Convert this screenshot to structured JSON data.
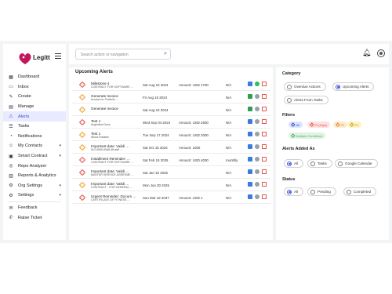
{
  "brand": {
    "name": "Legitt"
  },
  "sidebar": {
    "items": [
      {
        "label": "Dashboard",
        "icon": "grid-icon"
      },
      {
        "label": "Inbox",
        "icon": "inbox-icon"
      },
      {
        "label": "Create",
        "icon": "edit-icon"
      },
      {
        "label": "Manage",
        "icon": "folder-icon"
      },
      {
        "label": "Alerts",
        "icon": "alert-icon",
        "active": true
      },
      {
        "label": "Tasks",
        "icon": "tasks-icon"
      },
      {
        "label": "Notifications",
        "icon": "bell-icon"
      },
      {
        "label": "My Contacts",
        "icon": "contacts-icon",
        "caret": "▾"
      },
      {
        "label": "Smart Contract",
        "icon": "contract-icon",
        "caret": "▾"
      },
      {
        "label": "Repo Analyzer",
        "icon": "analyzer-icon"
      },
      {
        "label": "Reports & Analytics",
        "icon": "chart-icon"
      },
      {
        "label": "Org Settings",
        "icon": "org-icon",
        "caret": "▾"
      },
      {
        "label": "Settings",
        "icon": "gear-icon",
        "caret": "▾"
      },
      {
        "label": "Feedback",
        "icon": "feedback-icon"
      },
      {
        "label": "Raise Ticket",
        "icon": "ticket-icon"
      }
    ]
  },
  "search": {
    "placeholder": "Search action or navigation"
  },
  "alerts": {
    "title": "Upcoming Alerts",
    "rows": [
      {
        "title": "Milestone 4",
        "sub": "CONTRACT FOR SOFTWARE ...",
        "date": "Sat Aug 10 2024",
        "amount": "Amount: USD 1700",
        "freq": "N/A",
        "color": "#e5534b",
        "cal": "blue",
        "check": "green"
      },
      {
        "title": "Generate Invoice",
        "sub": "Invoice for Portfolio ...",
        "date": "Fri Aug 16 2024",
        "amount": "",
        "freq": "N/A",
        "color": "#f0a030",
        "cal": "green",
        "check": "grey"
      },
      {
        "title": "Generate Invoice",
        "sub": "",
        "date": "Sat Aug 10 2024",
        "amount": "",
        "freq": "N/A",
        "color": "#f0a030",
        "cal": "green",
        "check": "grey"
      },
      {
        "title": "Test 1",
        "sub": "Argentina Docs",
        "date": "Wed Sep 04 2024",
        "amount": "Amount: USD 2500",
        "freq": "N/A",
        "color": "#e5534b",
        "cal": "blue",
        "check": "grey"
      },
      {
        "title": "Test 1",
        "sub": "About Instates",
        "date": "Tue Sep 17 2024",
        "amount": "Amount: USD 2000",
        "freq": "N/A",
        "color": "#f0a030",
        "cal": "blue",
        "check": "grey"
      },
      {
        "title": "Important date: Validi ...",
        "sub": "5c718994-f5d8-4ff-ab8 ...",
        "date": "Sat Oct 15 2024",
        "amount": "Amount: 1000",
        "freq": "N/A",
        "color": "#f0a030",
        "cal": "blue",
        "check": "grey"
      },
      {
        "title": "Installment Reminder: ...",
        "sub": "CONTRACT FOR SOFTWARE ...",
        "date": "Sat Feb 15 2025",
        "amount": "Amount: USD 4000",
        "freq": "monthly",
        "color": "#e5534b",
        "cal": "blue",
        "check": "grey"
      },
      {
        "title": "Important date: Validi ...",
        "sub": "MASTER SERVICE AGREEME ...",
        "date": "Sat Jan 15 2025",
        "amount": "",
        "freq": "N/A",
        "color": "#e5534b",
        "cal": "blue",
        "check": "grey"
      },
      {
        "title": "Important date: Validi ...",
        "sub": "CONTRACT - FOR GENERAL ...",
        "date": "Mon Jun 30 2025",
        "amount": "",
        "freq": "N/A",
        "color": "#f0a030",
        "cal": "blue",
        "check": "grey"
      },
      {
        "title": "Urgent Reminder: Docum ...",
        "sub": "CERTIFICATE OF FITNESS ...",
        "date": "Sun Mar 22 2037",
        "amount": "Amount: USD 1",
        "freq": "N/A",
        "color": "#e5534b",
        "cal": "blue",
        "check": "grey"
      }
    ]
  },
  "category": {
    "title": "Category",
    "options": [
      "Overdue Actions",
      "Upcoming Alerts",
      "Alerts From Tasks"
    ],
    "selected": "Upcoming Alerts"
  },
  "filters": {
    "title": "Filters",
    "chips": [
      {
        "label": "All",
        "bg": "#dbe4ff",
        "fg": "#3b4fd8"
      },
      {
        "label": "P1(High)",
        "bg": "#fde2e0",
        "fg": "#e5534b"
      },
      {
        "label": "P2",
        "bg": "#fdebd2",
        "fg": "#e08a20"
      },
      {
        "label": "P3",
        "bg": "#fff3c4",
        "fg": "#c9a21a"
      },
      {
        "label": "Multiple Conditions",
        "bg": "#dff3e3",
        "fg": "#4caf6a"
      }
    ]
  },
  "added_as": {
    "title": "Alerts Added As",
    "options": [
      "All",
      "Tasks",
      "Google Calendar"
    ],
    "selected": "All"
  },
  "status": {
    "title": "Status",
    "options": [
      "All",
      "Pending",
      "Completed"
    ],
    "selected": "All"
  }
}
